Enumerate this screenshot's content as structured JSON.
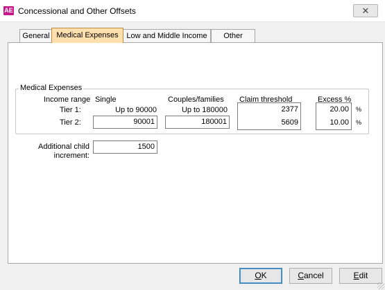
{
  "window": {
    "icon_text": "AE",
    "title": "Concessional and Other Offsets",
    "close_glyph": "✕"
  },
  "tabs": [
    {
      "label": "General",
      "active": false
    },
    {
      "label": "Medical Expenses",
      "active": true
    },
    {
      "label": "Low and Middle Income",
      "active": false
    },
    {
      "label": "Other",
      "active": false
    }
  ],
  "medical": {
    "group_title": "Medical Expenses",
    "headers": {
      "income_range": "Income range",
      "single": "Single",
      "couples": "Couples/families",
      "claim_threshold": "Claim threshold",
      "excess": "Excess %"
    },
    "tier1": {
      "label": "Tier 1:",
      "single": "Up to 90000",
      "couples": "Up to 180000",
      "claim": "2377",
      "excess": "20.00",
      "pct": "%"
    },
    "tier2": {
      "label": "Tier 2:",
      "single": "90001",
      "couples": "180001",
      "claim": "5609",
      "excess": "10.00",
      "pct": "%"
    },
    "child": {
      "label_line1": "Additional child",
      "label_line2": "increment:",
      "value": "1500"
    }
  },
  "buttons": {
    "ok": {
      "mnemonic": "O",
      "rest": "K"
    },
    "cancel": {
      "mnemonic": "C",
      "rest": "ancel"
    },
    "edit": {
      "mnemonic": "E",
      "rest": "dit"
    }
  }
}
